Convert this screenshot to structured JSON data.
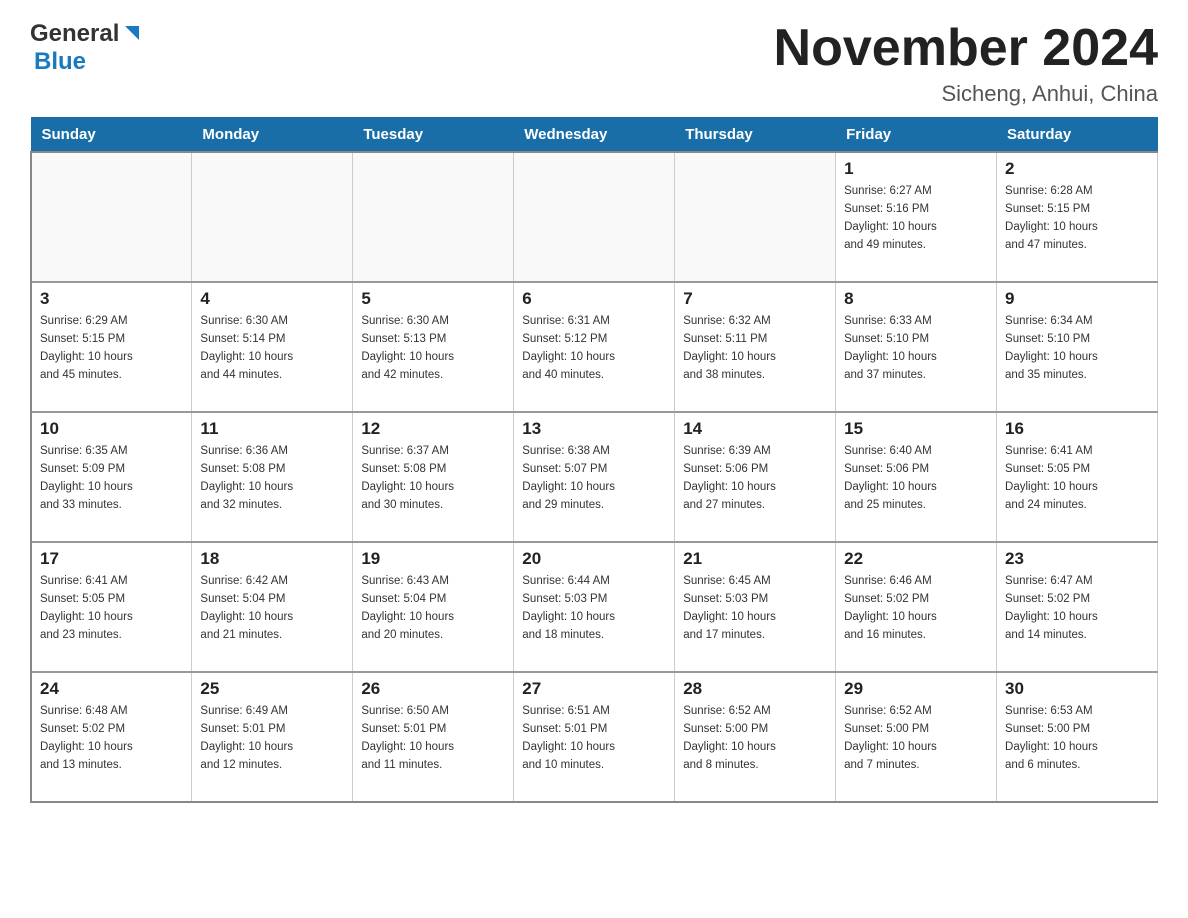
{
  "header": {
    "logo_line1": "General",
    "logo_line2": "Blue",
    "title": "November 2024",
    "subtitle": "Sicheng, Anhui, China"
  },
  "weekdays": [
    "Sunday",
    "Monday",
    "Tuesday",
    "Wednesday",
    "Thursday",
    "Friday",
    "Saturday"
  ],
  "weeks": [
    [
      {
        "day": "",
        "info": ""
      },
      {
        "day": "",
        "info": ""
      },
      {
        "day": "",
        "info": ""
      },
      {
        "day": "",
        "info": ""
      },
      {
        "day": "",
        "info": ""
      },
      {
        "day": "1",
        "info": "Sunrise: 6:27 AM\nSunset: 5:16 PM\nDaylight: 10 hours\nand 49 minutes."
      },
      {
        "day": "2",
        "info": "Sunrise: 6:28 AM\nSunset: 5:15 PM\nDaylight: 10 hours\nand 47 minutes."
      }
    ],
    [
      {
        "day": "3",
        "info": "Sunrise: 6:29 AM\nSunset: 5:15 PM\nDaylight: 10 hours\nand 45 minutes."
      },
      {
        "day": "4",
        "info": "Sunrise: 6:30 AM\nSunset: 5:14 PM\nDaylight: 10 hours\nand 44 minutes."
      },
      {
        "day": "5",
        "info": "Sunrise: 6:30 AM\nSunset: 5:13 PM\nDaylight: 10 hours\nand 42 minutes."
      },
      {
        "day": "6",
        "info": "Sunrise: 6:31 AM\nSunset: 5:12 PM\nDaylight: 10 hours\nand 40 minutes."
      },
      {
        "day": "7",
        "info": "Sunrise: 6:32 AM\nSunset: 5:11 PM\nDaylight: 10 hours\nand 38 minutes."
      },
      {
        "day": "8",
        "info": "Sunrise: 6:33 AM\nSunset: 5:10 PM\nDaylight: 10 hours\nand 37 minutes."
      },
      {
        "day": "9",
        "info": "Sunrise: 6:34 AM\nSunset: 5:10 PM\nDaylight: 10 hours\nand 35 minutes."
      }
    ],
    [
      {
        "day": "10",
        "info": "Sunrise: 6:35 AM\nSunset: 5:09 PM\nDaylight: 10 hours\nand 33 minutes."
      },
      {
        "day": "11",
        "info": "Sunrise: 6:36 AM\nSunset: 5:08 PM\nDaylight: 10 hours\nand 32 minutes."
      },
      {
        "day": "12",
        "info": "Sunrise: 6:37 AM\nSunset: 5:08 PM\nDaylight: 10 hours\nand 30 minutes."
      },
      {
        "day": "13",
        "info": "Sunrise: 6:38 AM\nSunset: 5:07 PM\nDaylight: 10 hours\nand 29 minutes."
      },
      {
        "day": "14",
        "info": "Sunrise: 6:39 AM\nSunset: 5:06 PM\nDaylight: 10 hours\nand 27 minutes."
      },
      {
        "day": "15",
        "info": "Sunrise: 6:40 AM\nSunset: 5:06 PM\nDaylight: 10 hours\nand 25 minutes."
      },
      {
        "day": "16",
        "info": "Sunrise: 6:41 AM\nSunset: 5:05 PM\nDaylight: 10 hours\nand 24 minutes."
      }
    ],
    [
      {
        "day": "17",
        "info": "Sunrise: 6:41 AM\nSunset: 5:05 PM\nDaylight: 10 hours\nand 23 minutes."
      },
      {
        "day": "18",
        "info": "Sunrise: 6:42 AM\nSunset: 5:04 PM\nDaylight: 10 hours\nand 21 minutes."
      },
      {
        "day": "19",
        "info": "Sunrise: 6:43 AM\nSunset: 5:04 PM\nDaylight: 10 hours\nand 20 minutes."
      },
      {
        "day": "20",
        "info": "Sunrise: 6:44 AM\nSunset: 5:03 PM\nDaylight: 10 hours\nand 18 minutes."
      },
      {
        "day": "21",
        "info": "Sunrise: 6:45 AM\nSunset: 5:03 PM\nDaylight: 10 hours\nand 17 minutes."
      },
      {
        "day": "22",
        "info": "Sunrise: 6:46 AM\nSunset: 5:02 PM\nDaylight: 10 hours\nand 16 minutes."
      },
      {
        "day": "23",
        "info": "Sunrise: 6:47 AM\nSunset: 5:02 PM\nDaylight: 10 hours\nand 14 minutes."
      }
    ],
    [
      {
        "day": "24",
        "info": "Sunrise: 6:48 AM\nSunset: 5:02 PM\nDaylight: 10 hours\nand 13 minutes."
      },
      {
        "day": "25",
        "info": "Sunrise: 6:49 AM\nSunset: 5:01 PM\nDaylight: 10 hours\nand 12 minutes."
      },
      {
        "day": "26",
        "info": "Sunrise: 6:50 AM\nSunset: 5:01 PM\nDaylight: 10 hours\nand 11 minutes."
      },
      {
        "day": "27",
        "info": "Sunrise: 6:51 AM\nSunset: 5:01 PM\nDaylight: 10 hours\nand 10 minutes."
      },
      {
        "day": "28",
        "info": "Sunrise: 6:52 AM\nSunset: 5:00 PM\nDaylight: 10 hours\nand 8 minutes."
      },
      {
        "day": "29",
        "info": "Sunrise: 6:52 AM\nSunset: 5:00 PM\nDaylight: 10 hours\nand 7 minutes."
      },
      {
        "day": "30",
        "info": "Sunrise: 6:53 AM\nSunset: 5:00 PM\nDaylight: 10 hours\nand 6 minutes."
      }
    ]
  ]
}
